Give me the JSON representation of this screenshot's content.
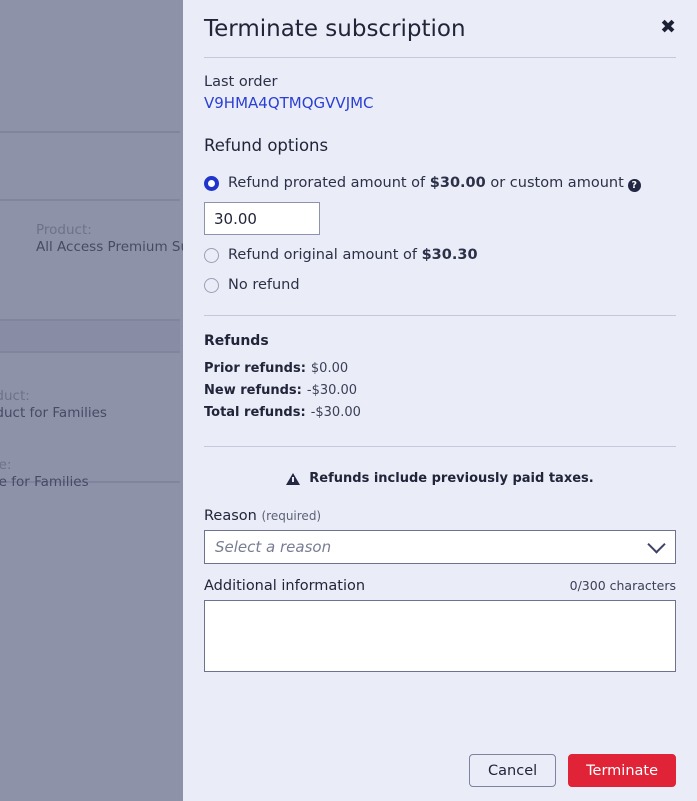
{
  "background": {
    "rows": [
      {
        "label": "Product:",
        "value": "All Access Premium Subscription"
      },
      {
        "label": "Product:",
        "value": "Product for Families"
      },
      {
        "label": "Price:",
        "value": "Price for Families"
      }
    ]
  },
  "modal": {
    "title": "Terminate subscription",
    "close_icon": "close-icon",
    "last_order": {
      "label": "Last order",
      "order_id": "V9HMA4QTMQGVVJMC"
    },
    "refund_options": {
      "heading": "Refund options",
      "options": [
        {
          "selected": true,
          "text_before": "Refund prorated amount of ",
          "amount": "$30.00",
          "text_after": " or custom amount",
          "help_icon": "help-icon"
        },
        {
          "selected": false,
          "text_before": "Refund original amount of ",
          "amount": "$30.30",
          "text_after": "",
          "help_icon": ""
        },
        {
          "selected": false,
          "text_before": "No refund",
          "amount": "",
          "text_after": "",
          "help_icon": ""
        }
      ],
      "custom_amount_value": "30.00",
      "custom_amount_placeholder": ""
    },
    "refunds": {
      "heading": "Refunds",
      "lines": [
        {
          "key": "Prior refunds:",
          "value": "$0.00"
        },
        {
          "key": "New refunds:",
          "value": "-$30.00"
        },
        {
          "key": "Total refunds:",
          "value": "-$30.00"
        }
      ]
    },
    "tax_notice": {
      "icon": "warning-icon",
      "text": "Refunds include previously paid taxes."
    },
    "reason": {
      "label": "Reason",
      "required_hint": "(required)",
      "placeholder": "Select a reason",
      "chevron_icon": "chevron-down-icon"
    },
    "additional": {
      "label": "Additional information",
      "counter": "0/300 characters",
      "value": "",
      "placeholder": ""
    },
    "footer": {
      "cancel_label": "Cancel",
      "terminate_label": "Terminate"
    }
  },
  "colors": {
    "modal_bg": "#eaedf7",
    "overlay": "#8d92a9",
    "link": "#2b3fd4",
    "radio_selected": "#1f35cc",
    "danger": "#e02337",
    "divider": "#c3c8dc"
  }
}
